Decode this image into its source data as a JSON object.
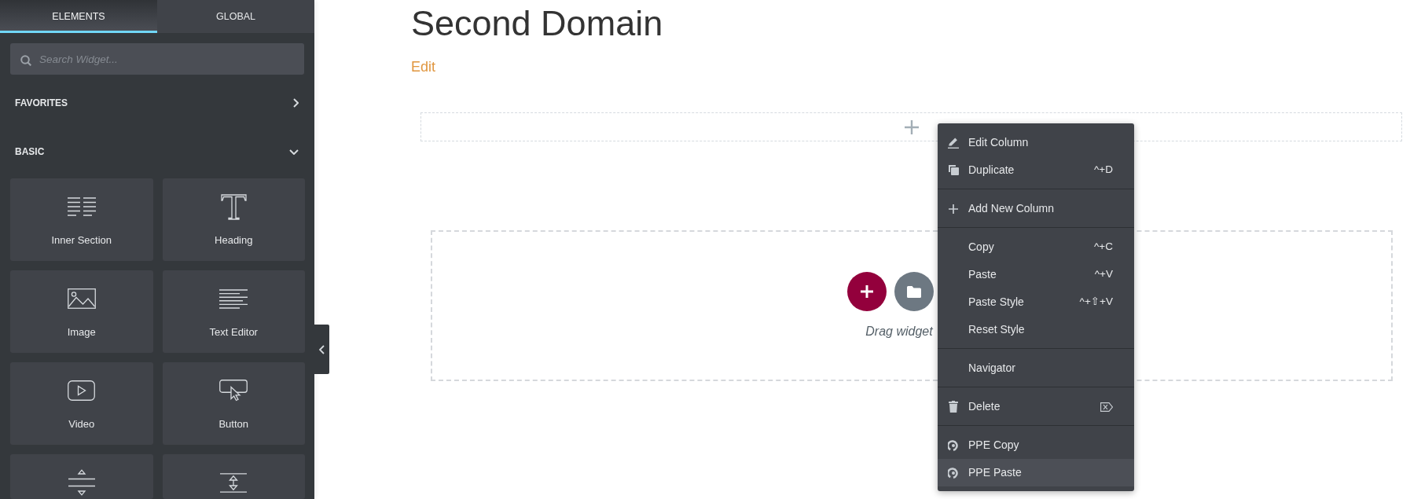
{
  "sidebar": {
    "tabs": [
      {
        "label": "ELEMENTS",
        "selected": true
      },
      {
        "label": "GLOBAL",
        "selected": false
      }
    ],
    "search": {
      "placeholder": "Search Widget..."
    },
    "categories": [
      {
        "label": "FAVORITES",
        "expanded": false
      },
      {
        "label": "BASIC",
        "expanded": true,
        "widgets": [
          {
            "kind": "inner_section",
            "label": "Inner Section"
          },
          {
            "kind": "heading",
            "label": "Heading"
          },
          {
            "kind": "image",
            "label": "Image"
          },
          {
            "kind": "text_editor",
            "label": "Text Editor"
          },
          {
            "kind": "video",
            "label": "Video"
          },
          {
            "kind": "button",
            "label": "Button"
          },
          {
            "kind": "divider"
          },
          {
            "kind": "spacer"
          }
        ]
      }
    ]
  },
  "page": {
    "title": "Second Domain",
    "edit_link": "Edit",
    "drop_zone": {
      "hint": "Drag widget"
    }
  },
  "context_menu": {
    "groups": [
      {
        "items": [
          {
            "kind": "edit",
            "label": "Edit Column",
            "selected": false
          },
          {
            "kind": "duplicate",
            "label": "Duplicate",
            "shortcut": "^+D",
            "selected": false
          }
        ]
      },
      {
        "items": [
          {
            "kind": "add",
            "label": "Add New Column",
            "selected": false
          }
        ]
      },
      {
        "items": [
          {
            "kind": "plain",
            "label": "Copy",
            "shortcut": "^+C",
            "selected": false
          },
          {
            "kind": "plain",
            "label": "Paste",
            "shortcut": "^+V",
            "selected": false
          },
          {
            "kind": "plain",
            "label": "Paste Style",
            "shortcut": "^+⇧+V",
            "selected": false
          },
          {
            "kind": "plain",
            "label": "Reset Style",
            "selected": false
          }
        ]
      },
      {
        "items": [
          {
            "kind": "plain",
            "label": "Navigator",
            "selected": false
          }
        ]
      },
      {
        "items": [
          {
            "kind": "delete",
            "label": "Delete",
            "selected": false
          }
        ]
      },
      {
        "items": [
          {
            "kind": "ppe",
            "label": "PPE Copy",
            "selected": false
          },
          {
            "kind": "ppe",
            "label": "PPE Paste",
            "selected": true
          }
        ]
      }
    ]
  }
}
